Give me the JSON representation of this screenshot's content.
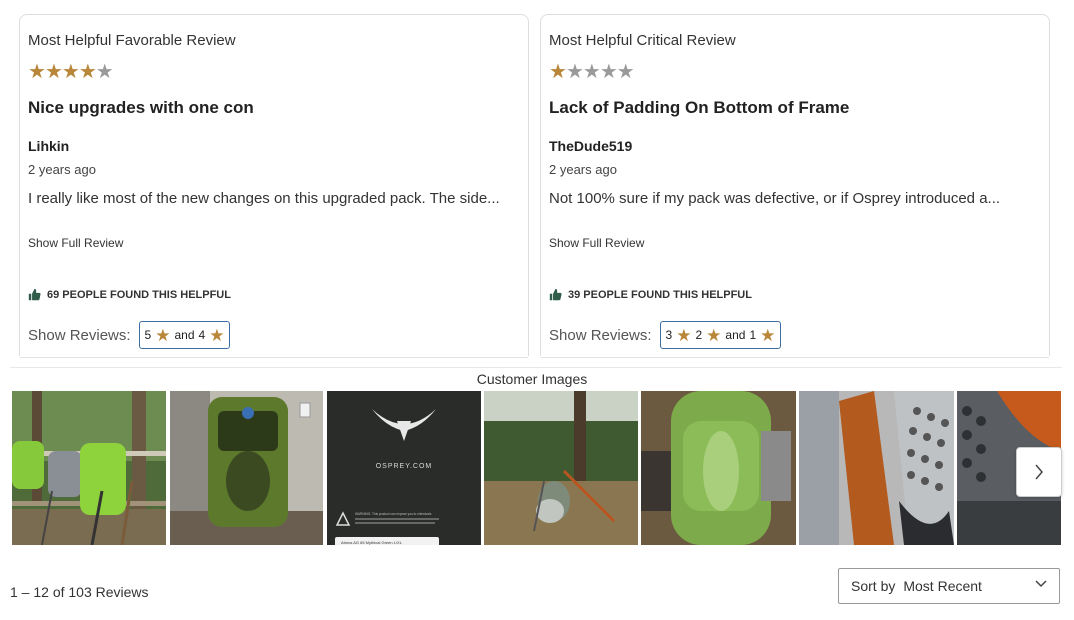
{
  "favorable": {
    "label": "Most Helpful Favorable Review",
    "rating": 4,
    "title": "Nice upgrades with one con",
    "author": "Lihkin",
    "date": "2 years ago",
    "excerpt": "I really like most of the new changes on this upgraded pack. The side...",
    "show_full": "Show Full Review",
    "helpful": "69 PEOPLE FOUND THIS HELPFUL",
    "show_reviews_label": "Show Reviews:",
    "filter": {
      "a": "5",
      "and": "and",
      "b": "4"
    }
  },
  "critical": {
    "label": "Most Helpful Critical Review",
    "rating": 1,
    "title": "Lack of Padding On Bottom of Frame",
    "author": "TheDude519",
    "date": "2 years ago",
    "excerpt": "Not 100% sure if my pack was defective, or if Osprey introduced a...",
    "show_full": "Show Full Review",
    "helpful": "39 PEOPLE FOUND THIS HELPFUL",
    "show_reviews_label": "Show Reviews:",
    "filter": {
      "a": "3",
      "b": "2",
      "and": "and",
      "c": "1"
    }
  },
  "customer_images": {
    "title": "Customer Images",
    "image3_brand": "OSPREY.COM",
    "image3_warning": "WARNING: This product can expose you to chemicals",
    "image3_tag": "Atmos AG 65 Mythical Green L/XL"
  },
  "reviews_count": "1 – 12 of 103 Reviews",
  "sort": {
    "prefix": "Sort by",
    "value": "Most Recent"
  },
  "colors": {
    "star": "#b8873a",
    "star_off": "#9a9a9a",
    "thumb": "#2f5d4a",
    "filter_border": "#3a6ea5"
  }
}
